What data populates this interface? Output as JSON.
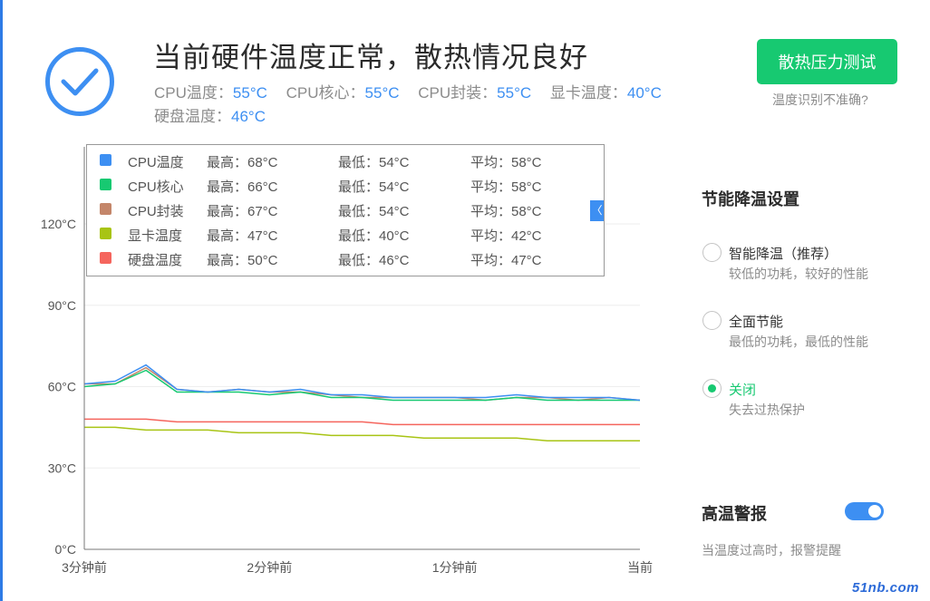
{
  "header": {
    "title": "当前硬件温度正常，散热情况良好",
    "status_icon": "check-circle-icon",
    "temps": [
      {
        "label": "CPU温度：",
        "value": "55°C"
      },
      {
        "label": "CPU核心：",
        "value": "55°C"
      },
      {
        "label": "CPU封装：",
        "value": "55°C"
      },
      {
        "label": "显卡温度：",
        "value": "40°C"
      },
      {
        "label": "硬盘温度：",
        "value": "46°C"
      }
    ],
    "stress_test_label": "散热压力测试",
    "inaccurate_link": "温度识别不准确?"
  },
  "legend": {
    "rows": [
      {
        "name": "CPU温度",
        "max": "最高：68°C",
        "min": "最低：54°C",
        "avg": "平均：58°C"
      },
      {
        "name": "CPU核心",
        "max": "最高：66°C",
        "min": "最低：54°C",
        "avg": "平均：58°C"
      },
      {
        "name": "CPU封装",
        "max": "最高：67°C",
        "min": "最低：54°C",
        "avg": "平均：58°C"
      },
      {
        "name": "显卡温度",
        "max": "最高：47°C",
        "min": "最低：40°C",
        "avg": "平均：42°C"
      },
      {
        "name": "硬盘温度",
        "max": "最高：50°C",
        "min": "最低：46°C",
        "avg": "平均：47°C"
      }
    ],
    "collapse_glyph": "〈"
  },
  "colors": {
    "accent": "#3d8ff2",
    "green": "#17c971",
    "series": [
      "#3d8ff2",
      "#17c971",
      "#c4866a",
      "#a8c414",
      "#f5655d"
    ]
  },
  "chart_data": {
    "type": "line",
    "ylim": [
      0,
      120
    ],
    "yticks": [
      0,
      30,
      60,
      90,
      120
    ],
    "ytick_labels": [
      "0°C",
      "30°C",
      "60°C",
      "90°C",
      "120°C"
    ],
    "x": [
      0,
      10,
      20,
      30,
      40,
      50,
      60,
      70,
      80,
      90,
      100,
      110,
      120,
      130,
      140,
      150,
      160,
      170,
      180
    ],
    "x_range": [
      0,
      180
    ],
    "x_tick_positions": [
      0,
      60,
      120,
      180
    ],
    "x_tick_labels": [
      "3分钟前",
      "2分钟前",
      "1分钟前",
      "当前"
    ],
    "grid": true,
    "series": [
      {
        "name": "CPU温度",
        "values": [
          61,
          62,
          68,
          59,
          58,
          59,
          58,
          59,
          57,
          57,
          56,
          56,
          56,
          56,
          57,
          56,
          56,
          56,
          55
        ]
      },
      {
        "name": "CPU核心",
        "values": [
          60,
          61,
          66,
          58,
          58,
          58,
          57,
          58,
          56,
          56,
          55,
          55,
          55,
          55,
          56,
          55,
          55,
          55,
          55
        ]
      },
      {
        "name": "CPU封装",
        "values": [
          61,
          61,
          67,
          59,
          58,
          59,
          58,
          58,
          57,
          56,
          56,
          56,
          56,
          55,
          56,
          56,
          55,
          56,
          55
        ]
      },
      {
        "name": "显卡温度",
        "values": [
          45,
          45,
          44,
          44,
          44,
          43,
          43,
          43,
          42,
          42,
          42,
          41,
          41,
          41,
          41,
          40,
          40,
          40,
          40
        ]
      },
      {
        "name": "硬盘温度",
        "values": [
          48,
          48,
          48,
          47,
          47,
          47,
          47,
          47,
          47,
          47,
          46,
          46,
          46,
          46,
          46,
          46,
          46,
          46,
          46
        ]
      }
    ]
  },
  "cooling": {
    "title": "节能降温设置",
    "options": [
      {
        "label": "智能降温（推荐）",
        "desc": "较低的功耗，较好的性能",
        "selected": false
      },
      {
        "label": "全面节能",
        "desc": "最低的功耗，最低的性能",
        "selected": false
      },
      {
        "label": "关闭",
        "desc": "失去过热保护",
        "selected": true
      }
    ]
  },
  "alarm": {
    "title": "高温警报",
    "enabled": true,
    "desc": "当温度过高时，报警提醒"
  },
  "watermark": "51nb.com"
}
